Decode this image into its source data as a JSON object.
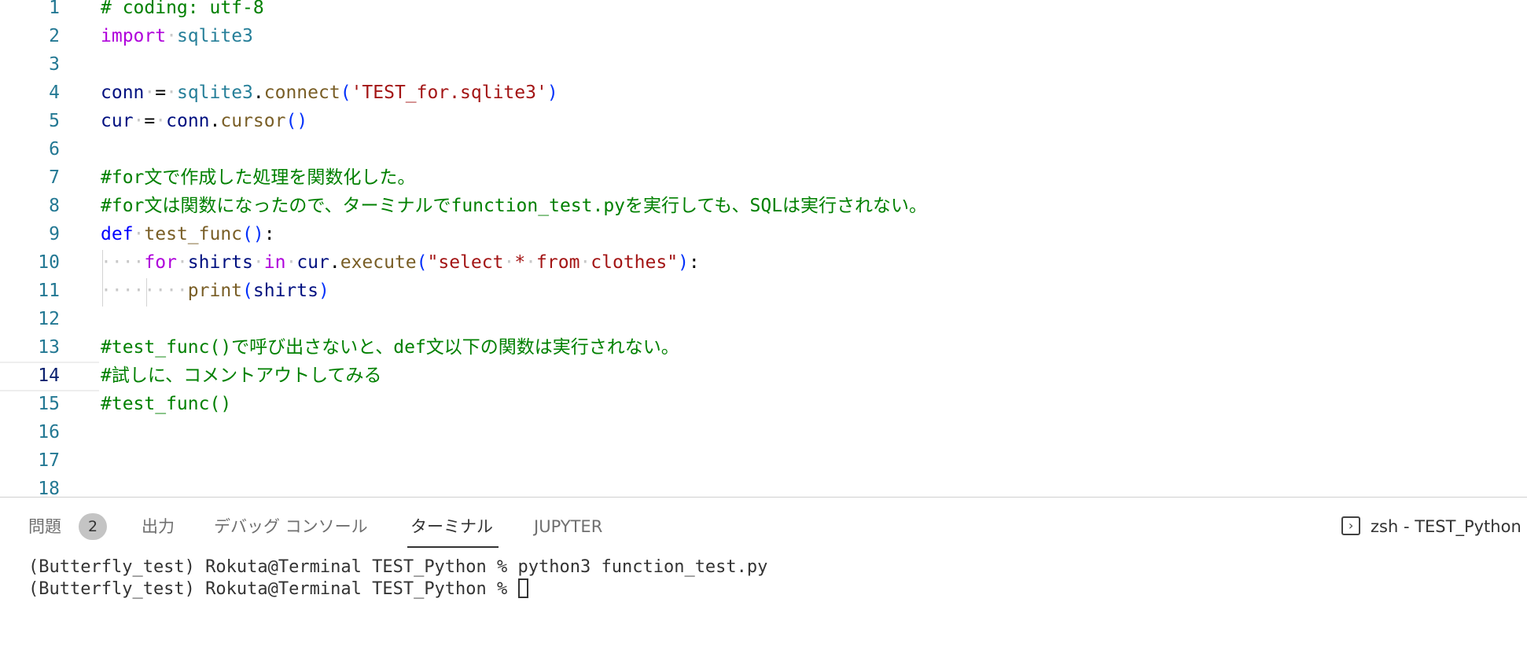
{
  "editor": {
    "lines": [
      {
        "num": "1",
        "tokens": [
          [
            "t-cmt",
            "# coding: utf-8"
          ]
        ]
      },
      {
        "num": "2",
        "tokens": [
          [
            "t-kw",
            "import"
          ],
          [
            "t-ws",
            "·"
          ],
          [
            "t-mod",
            "sqlite3"
          ]
        ]
      },
      {
        "num": "3",
        "tokens": []
      },
      {
        "num": "4",
        "tokens": [
          [
            "t-var",
            "conn"
          ],
          [
            "t-ws",
            "·"
          ],
          [
            "t-punc",
            "="
          ],
          [
            "t-ws",
            "·"
          ],
          [
            "t-mod",
            "sqlite3"
          ],
          [
            "t-punc",
            "."
          ],
          [
            "t-fn",
            "connect"
          ],
          [
            "t-par",
            "("
          ],
          [
            "t-str",
            "'TEST_for.sqlite3'"
          ],
          [
            "t-par",
            ")"
          ]
        ]
      },
      {
        "num": "5",
        "tokens": [
          [
            "t-var",
            "cur"
          ],
          [
            "t-ws",
            "·"
          ],
          [
            "t-punc",
            "="
          ],
          [
            "t-ws",
            "·"
          ],
          [
            "t-var",
            "conn"
          ],
          [
            "t-punc",
            "."
          ],
          [
            "t-fn",
            "cursor"
          ],
          [
            "t-par",
            "()"
          ]
        ]
      },
      {
        "num": "6",
        "tokens": []
      },
      {
        "num": "7",
        "tokens": [
          [
            "t-cmt",
            "#for文で作成した処理を関数化した。"
          ]
        ]
      },
      {
        "num": "8",
        "tokens": [
          [
            "t-cmt",
            "#for文は関数になったので、ターミナルでfunction_test.pyを実行しても、SQLは実行されない。"
          ]
        ]
      },
      {
        "num": "9",
        "tokens": [
          [
            "t-def",
            "def"
          ],
          [
            "t-ws",
            "·"
          ],
          [
            "t-fn",
            "test_func"
          ],
          [
            "t-par",
            "()"
          ],
          [
            "t-punc",
            ":"
          ]
        ]
      },
      {
        "num": "10",
        "tokens": [
          [
            "t-ws",
            "····"
          ],
          [
            "t-kw",
            "for"
          ],
          [
            "t-ws",
            "·"
          ],
          [
            "t-var",
            "shirts"
          ],
          [
            "t-ws",
            "·"
          ],
          [
            "t-kw",
            "in"
          ],
          [
            "t-ws",
            "·"
          ],
          [
            "t-var",
            "cur"
          ],
          [
            "t-punc",
            "."
          ],
          [
            "t-fn",
            "execute"
          ],
          [
            "t-par",
            "("
          ],
          [
            "t-str",
            "\"select"
          ],
          [
            "t-ws",
            "·"
          ],
          [
            "t-str",
            "*"
          ],
          [
            "t-ws",
            "·"
          ],
          [
            "t-str",
            "from"
          ],
          [
            "t-ws",
            "·"
          ],
          [
            "t-str",
            "clothes\""
          ],
          [
            "t-par",
            ")"
          ],
          [
            "t-punc",
            ":"
          ]
        ]
      },
      {
        "num": "11",
        "tokens": [
          [
            "t-ws",
            "········"
          ],
          [
            "t-fn",
            "print"
          ],
          [
            "t-par",
            "("
          ],
          [
            "t-var",
            "shirts"
          ],
          [
            "t-par",
            ")"
          ]
        ]
      },
      {
        "num": "12",
        "tokens": []
      },
      {
        "num": "13",
        "tokens": [
          [
            "t-cmt",
            "#test_func()で呼び出さないと、def文以下の関数は実行されない。"
          ]
        ]
      },
      {
        "num": "14",
        "tokens": [
          [
            "t-cmt",
            "#試しに、コメントアウトしてみる"
          ]
        ]
      },
      {
        "num": "15",
        "tokens": [
          [
            "t-cmt",
            "#test_func()"
          ]
        ]
      },
      {
        "num": "16",
        "tokens": []
      },
      {
        "num": "17",
        "tokens": []
      },
      {
        "num": "18",
        "tokens": []
      }
    ],
    "active_line": "14"
  },
  "panel": {
    "tabs": {
      "problems": "問題",
      "problems_count": "2",
      "output": "出力",
      "debug_console": "デバッグ コンソール",
      "terminal": "ターミナル",
      "jupyter": "JUPYTER"
    },
    "active_tab": "terminal",
    "terminal_icon": "terminal-icon",
    "terminal_name": "zsh - TEST_Python",
    "terminal_lines": [
      "(Butterfly_test) Rokuta@Terminal TEST_Python % python3 function_test.py",
      "(Butterfly_test) Rokuta@Terminal TEST_Python % "
    ]
  }
}
